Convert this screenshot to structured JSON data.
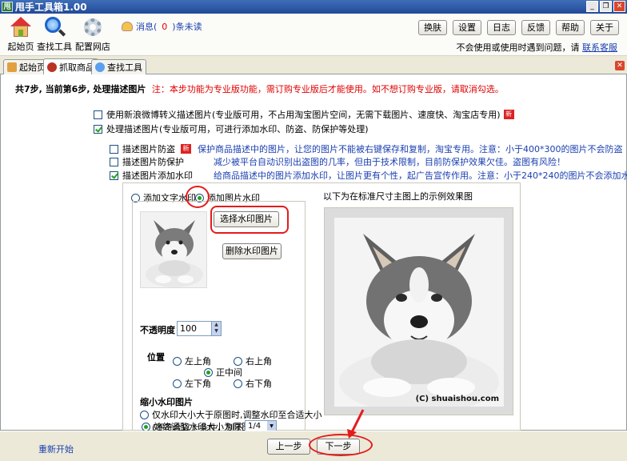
{
  "window": {
    "title": "甩手工具箱1.00",
    "app_icon_text": "甩"
  },
  "toolbar": {
    "tools": [
      {
        "label": "起始页",
        "icon": "home-icon"
      },
      {
        "label": "查找工具",
        "icon": "magnifier-icon"
      },
      {
        "label": "配置网店",
        "icon": "gear-icon"
      }
    ],
    "message_prefix": "消息(",
    "message_count": "0",
    "message_suffix": ")条未读",
    "buttons": [
      "换肤",
      "设置",
      "日志",
      "反馈",
      "帮助",
      "关于"
    ],
    "notice_text": "不会使用或使用时遇到问题，请",
    "notice_link": "联系客服"
  },
  "tabs": [
    {
      "label": "起始页",
      "active": false
    },
    {
      "label": "抓取商品",
      "active": true
    },
    {
      "label": "查找工具",
      "active": false
    }
  ],
  "step": {
    "title": "共7步, 当前第6步, 处理描述图片",
    "note": "注：本步功能为专业版功能，需订购专业版后才能使用。如不想订购专业版，请取消勾选。"
  },
  "options": {
    "sina": {
      "label": "使用新浪微博转义描述图片(专业版可用，不占用淘宝图片空间，无需下载图片、速度快、淘宝店专用)",
      "checked": false,
      "badge": "新"
    },
    "process": {
      "label": "处理描述图片(专业版可用，可进行添加水印、防盗、防保护等处理)",
      "checked": true
    },
    "antitheft": {
      "label": "描述图片防盗",
      "checked": false,
      "badge": "新",
      "desc": "保护商品描述中的图片，让您的图片不能被右键保存和复制，淘宝专用。注意：小于400*300的图片不会防盗"
    },
    "protect": {
      "label": "描述图片防保护",
      "checked": false,
      "desc": "减少被平台自动识别出盗图的几率，但由于技术限制，目前防保护效果欠佳。盗图有风险！"
    },
    "watermark": {
      "label": "描述图片添加水印",
      "checked": true,
      "desc": "给商品描述中的图片添加水印，让图片更有个性，起广告宣传作用。注意：小于240*240的图片不会添加水印"
    }
  },
  "watermark": {
    "text_radio": "添加文字水印",
    "image_radio": "添加图片水印",
    "choose_button": "选择水印图片",
    "delete_button": "删除水印图片",
    "opacity_label": "不透明度",
    "opacity_value": "100",
    "position_label": "位置",
    "positions": {
      "top_left": "左上角",
      "top_right": "右上角",
      "center": "正中间",
      "bottom_left": "左下角",
      "bottom_right": "右下角"
    },
    "selected_position": "center",
    "shrink_label": "缩小水印图片",
    "shrink_option1": "仅水印大小大于原图时,调整水印至合适大小",
    "shrink_option1_note": "(不符合以上条件，则不调整)",
    "shrink_option2": "始终调整水印大小为原图的",
    "shrink_ratio": "1/4",
    "preview_caption": "以下为在标准尺寸主图上的示例效果图",
    "copyright": "(C) shuaishou.com"
  },
  "footer": {
    "restart": "重新开始",
    "prev_button": "上一步",
    "next_button": "下一步"
  },
  "colors": {
    "accent_red": "#e41b1b",
    "link_blue": "#1a3fb0",
    "check_green": "#21a121"
  }
}
